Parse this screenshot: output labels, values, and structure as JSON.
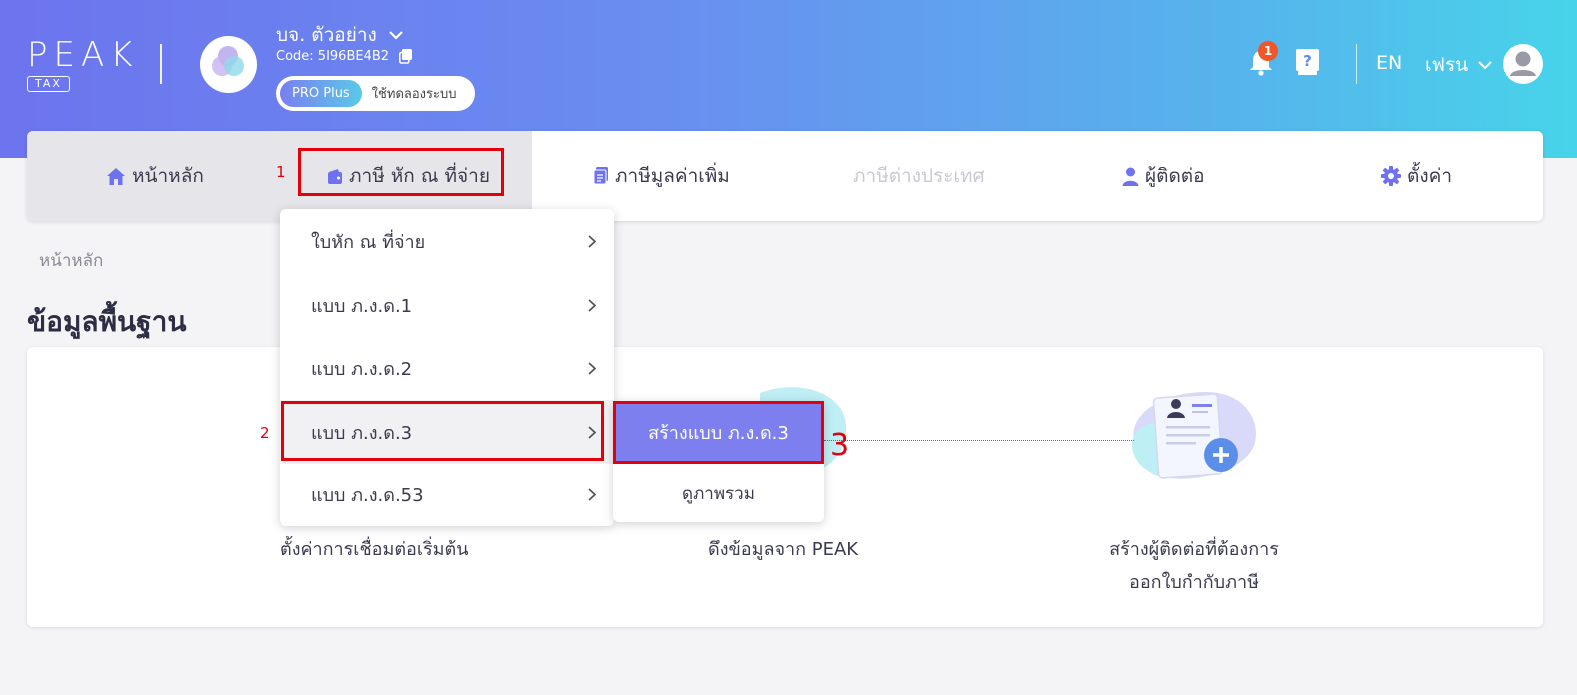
{
  "header": {
    "logo_text": "PEAK",
    "logo_tax": "TAX",
    "company_name": "บจ. ตัวอย่าง",
    "company_code": "Code: 5I96BE4B2",
    "plan_badge": "PRO Plus",
    "plan_trial": "ใช้ทดลองระบบ",
    "notification_count": "1",
    "language": "EN",
    "username": "เฟรน"
  },
  "nav": {
    "items": [
      {
        "label": "หน้าหลัก",
        "icon": "home-icon"
      },
      {
        "label": "ภาษี หัก ณ ที่จ่าย",
        "icon": "wallet-icon"
      },
      {
        "label": "ภาษีมูลค่าเพิ่ม",
        "icon": "document-icon"
      },
      {
        "label": "ภาษีต่างประเทศ",
        "icon": ""
      },
      {
        "label": "ผู้ติดต่อ",
        "icon": "person-icon"
      },
      {
        "label": "ตั้งค่า",
        "icon": "gear-icon"
      }
    ]
  },
  "annotations": {
    "step1": "1",
    "step2": "2",
    "step3": "3"
  },
  "breadcrumb": "หน้าหลัก",
  "page_title": "ข้อมูลพื้นฐาน",
  "steps": [
    {
      "caption": "ตั้งค่าการเชื่อมต่อเริ่มต้น"
    },
    {
      "caption": "ดึงข้อมูลจาก PEAK"
    },
    {
      "caption_line1": "สร้างผู้ติดต่อที่ต้องการ",
      "caption_line2": "ออกใบกำกับภาษี"
    }
  ],
  "menu": {
    "items": [
      {
        "label": "ใบหัก ณ ที่จ่าย"
      },
      {
        "label": "แบบ ภ.ง.ด.1"
      },
      {
        "label": "แบบ ภ.ง.ด.2"
      },
      {
        "label": "แบบ ภ.ง.ด.3"
      },
      {
        "label": "แบบ ภ.ง.ด.53"
      }
    ]
  },
  "submenu": {
    "create_label": "สร้างแบบ ภ.ง.ด.3",
    "overview_label": "ดูภาพรวม"
  }
}
